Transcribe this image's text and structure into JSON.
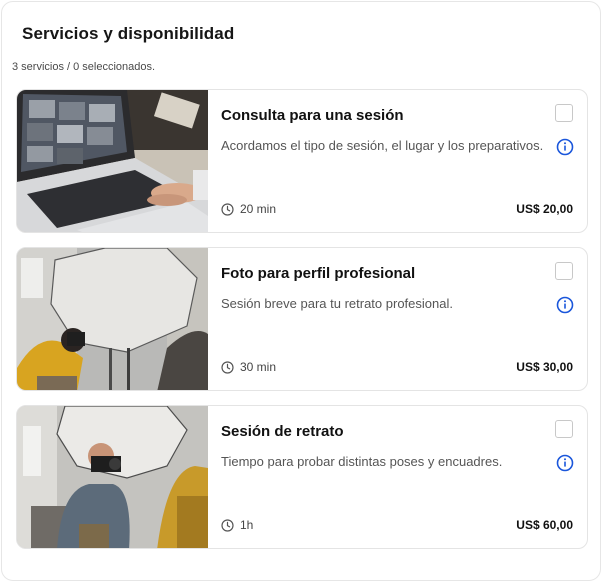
{
  "panel": {
    "title": "Servicios y disponibilidad",
    "summary": "3 servicios / 0 seleccionados."
  },
  "services": [
    {
      "name": "Consulta para una sesión",
      "description": "Acordamos el tipo de sesión, el lugar y los preparativos.",
      "duration": "20 min",
      "price": "US$ 20,00",
      "selected": false,
      "image": "laptop-photo-editing"
    },
    {
      "name": "Foto para perfil profesional",
      "description": "Sesión breve para tu retrato profesional.",
      "duration": "30 min",
      "price": "US$ 30,00",
      "selected": false,
      "image": "photographer-softbox-studio"
    },
    {
      "name": "Sesión de retrato",
      "description": "Tiempo para probar distintas poses y encuadres.",
      "duration": "1h",
      "price": "US$ 60,00",
      "selected": false,
      "image": "photographer-shooting-portrait"
    }
  ],
  "icons": {
    "info": "info-circle-icon",
    "duration": "clock-icon"
  },
  "colors": {
    "accent": "#1a56db",
    "border": "#e4e4e4",
    "text_muted": "#555555"
  }
}
